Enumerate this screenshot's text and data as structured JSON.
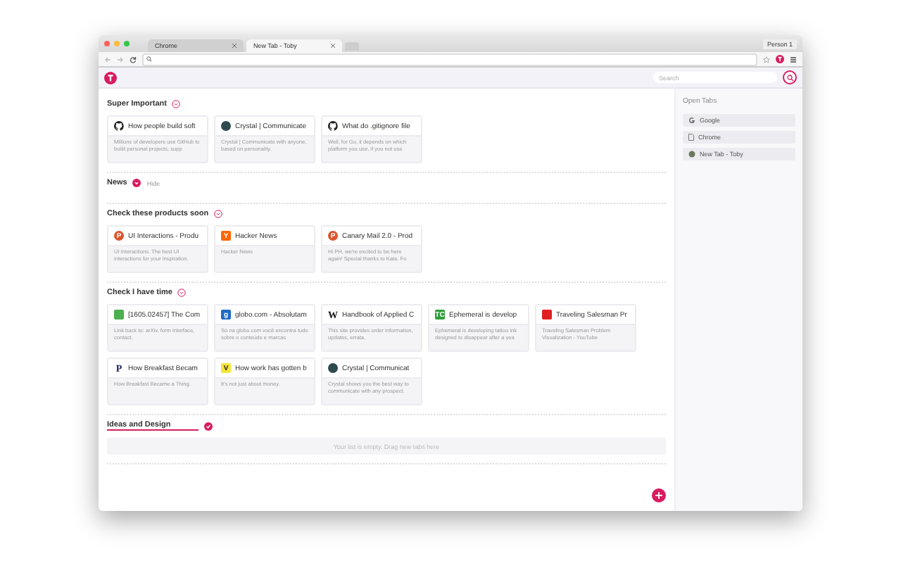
{
  "browser": {
    "tabs": [
      {
        "label": "Chrome",
        "selected": false
      },
      {
        "label": "New Tab - Toby",
        "selected": true
      }
    ],
    "profile": "Person 1"
  },
  "toby": {
    "search": {
      "placeholder": "Search"
    }
  },
  "collections": [
    {
      "title": "Super Important",
      "expanded": true,
      "cards": [
        {
          "title": "How people build soft",
          "description": "Millions of developers use GitHub to build personal projects, supp"
        },
        {
          "title": "Crystal | Communicate",
          "description": "Crystal | Communicate with anyone, based on personality."
        },
        {
          "title": "What do .gitignore file",
          "description": "Well, for Go, it depends on which platform you use, if you not use"
        }
      ]
    },
    {
      "title": "News",
      "expanded": false,
      "hint": "Hide"
    },
    {
      "title": "Check these products soon",
      "expanded": true,
      "cards": [
        {
          "title": "UI Interactions - Produ",
          "description": "UI Interactions. The best UI interactions for your inspiration.",
          "glyph": "P"
        },
        {
          "title": "Hacker News",
          "description": "Hacker News",
          "glyph": "Y"
        },
        {
          "title": "Canary Mail 2.0 - Prod",
          "description": "Hi PH, we're excited to be here again! Special thanks to Kate. Fo",
          "glyph": "P"
        }
      ]
    },
    {
      "title": "Check I have time",
      "expanded": true,
      "cards": [
        {
          "title": "[1605.02457] The Com",
          "description": "Link back to: arXiv, form interface, contact."
        },
        {
          "title": "globo.com - Absolutam",
          "description": "Só na globo.com você encontra tudo sobre o conteúdo e marcas",
          "glyph": "g"
        },
        {
          "title": "Handbook of Applied C",
          "description": "This site provides order information, updates, errata,",
          "glyph": "W"
        },
        {
          "title": "Ephemeral is develop",
          "description": "Ephemeral is developing tattoo ink designed to disappear after a yea",
          "glyph": "TC"
        },
        {
          "title": "Traveling Salesman Pr",
          "description": "Traveling Salesman Problem Visualization - YouTube"
        },
        {
          "title": "How Breakfast Becam",
          "description": "How Breakfast Became a Thing.",
          "glyph": "P"
        },
        {
          "title": "How work has gotten b",
          "description": "It's not just about money.",
          "glyph": "V"
        },
        {
          "title": "Crystal | Communicat",
          "description": "Crystal shows you the best way to communicate with any prospect."
        }
      ]
    },
    {
      "title": "Ideas and Design",
      "expanded": true,
      "editing": true,
      "empty_text": "Your list is empty. Drag new tabs here"
    }
  ],
  "sidebar": {
    "title": "Open Tabs",
    "items": [
      {
        "label": "Google"
      },
      {
        "label": "Chrome"
      },
      {
        "label": "New Tab - Toby"
      }
    ]
  }
}
